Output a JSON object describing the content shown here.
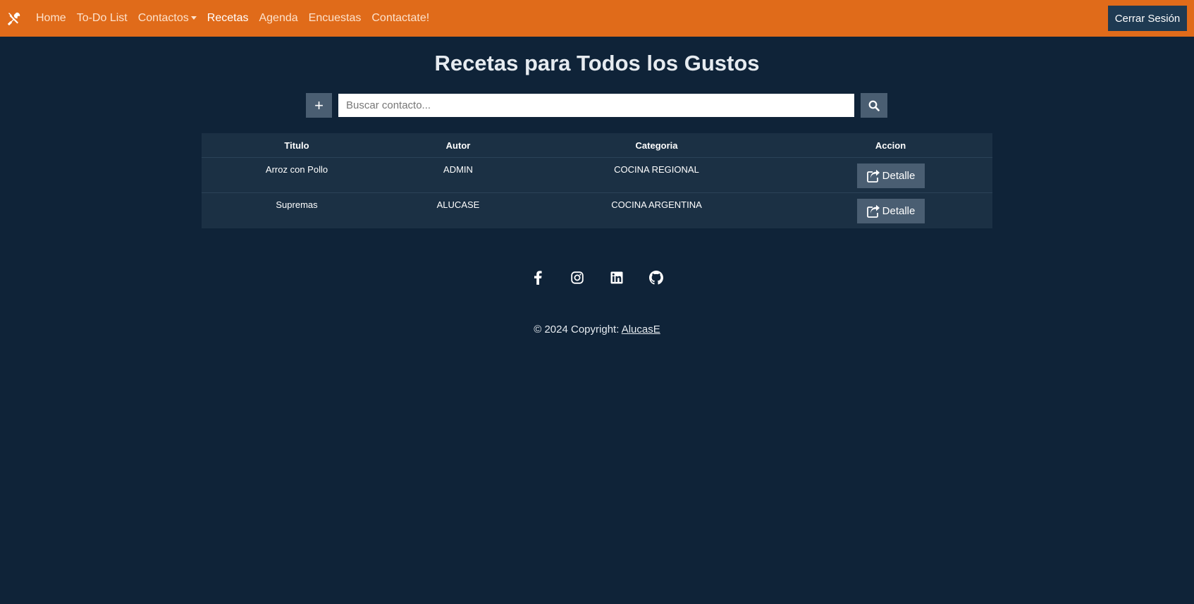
{
  "navbar": {
    "brand_icon": "tools-icon",
    "links": [
      {
        "label": "Home"
      },
      {
        "label": "To-Do List"
      },
      {
        "label": "Contactos"
      },
      {
        "label": "Recetas"
      },
      {
        "label": "Agenda"
      },
      {
        "label": "Encuestas"
      },
      {
        "label": "Contactate!"
      }
    ],
    "logout_label": "Cerrar Sesión",
    "accent_color": "#e06b1a"
  },
  "page": {
    "title": "Recetas para Todos los Gustos"
  },
  "search": {
    "add_label": "+",
    "placeholder": "Buscar contacto...",
    "value": ""
  },
  "table": {
    "headers": [
      "Titulo",
      "Autor",
      "Categoria",
      "Accion"
    ],
    "rows": [
      {
        "titulo": "Arroz con Pollo",
        "autor": "ADMIN",
        "categoria": "COCINA REGIONAL",
        "accion": "Detalle"
      },
      {
        "titulo": "Supremas",
        "autor": "ALUCASE",
        "categoria": "COCINA ARGENTINA",
        "accion": "Detalle"
      }
    ]
  },
  "footer": {
    "social_icons": [
      "facebook-icon",
      "instagram-icon",
      "linkedin-icon",
      "github-icon"
    ],
    "copyright_text": "© 2024 Copyright: ",
    "copyright_link": "AlucasE"
  }
}
